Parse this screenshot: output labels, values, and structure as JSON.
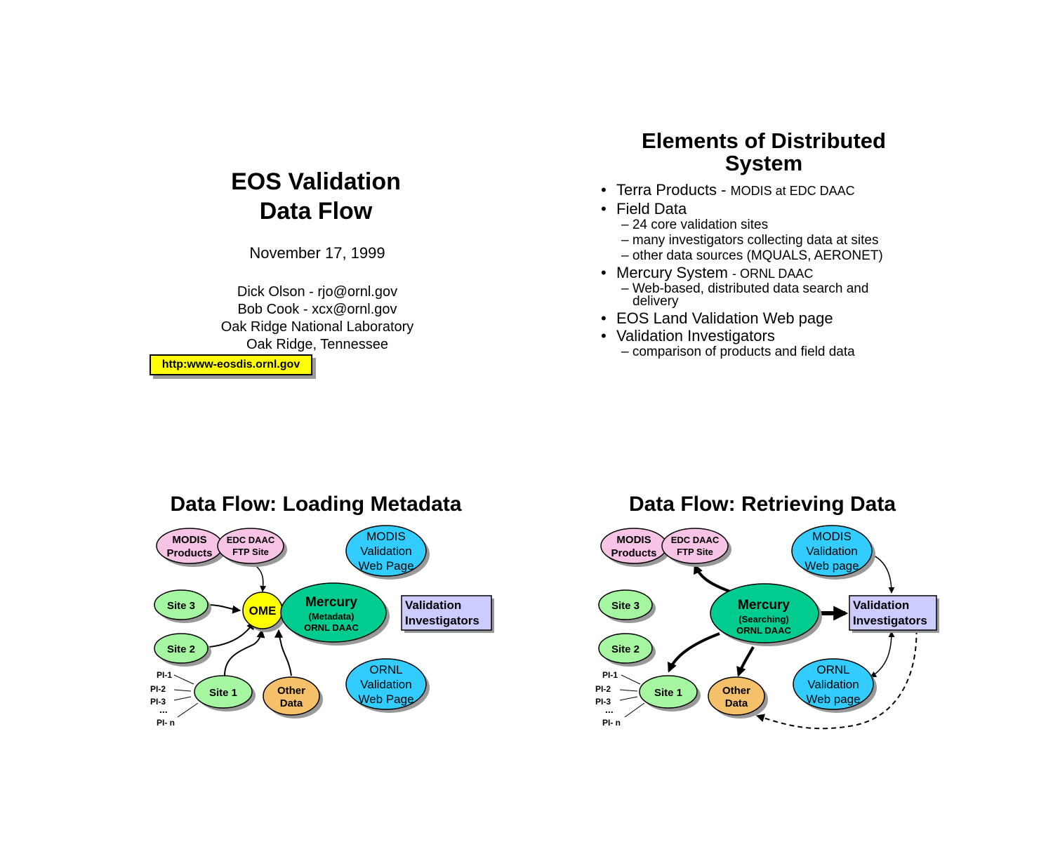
{
  "slide1": {
    "title_line1": "EOS Validation",
    "title_line2": "Data Flow",
    "date": "November 17, 1999",
    "credit1": "Dick Olson - rjo@ornl.gov",
    "credit2": "Bob Cook - xcx@ornl.gov",
    "credit3": "Oak Ridge National Laboratory",
    "credit4": "Oak Ridge, Tennessee",
    "url": "http:www-eosdis.ornl.gov"
  },
  "slide2": {
    "title_line1": "Elements of Distributed",
    "title_line2": "System",
    "bullet_char": "•",
    "b1_main": "Terra Products - ",
    "b1_small": "MODIS at EDC DAAC",
    "b2_main": "Field Data",
    "b2_sub1": "– 24 core validation sites",
    "b2_sub2": "– many investigators collecting data at sites",
    "b2_sub3": "– other data sources (MQUALS, AERONET)",
    "b3_main": "Mercury System ",
    "b3_small": "- ORNL DAAC",
    "b3_sub1a": "– Web-based, distributed data search and",
    "b3_sub1b": "delivery",
    "b4_main": "EOS Land Validation Web page",
    "b5_main": "Validation Investigators",
    "b5_sub1": "– comparison of products and field data"
  },
  "slide3": {
    "title": "Data Flow: Loading Metadata",
    "modis_products": [
      "MODIS",
      "Products"
    ],
    "edc_daac": [
      "EDC DAAC",
      "FTP Site"
    ],
    "modis_web": [
      "MODIS",
      "Validation",
      "Web Page"
    ],
    "site3": "Site 3",
    "site2": "Site 2",
    "site1": "Site 1",
    "ome": "OME",
    "mercury": "Mercury",
    "mercury_sub1": "(Metadata)",
    "mercury_sub2": "ORNL DAAC",
    "validation": [
      "Validation",
      "Investigators"
    ],
    "other_data": [
      "Other",
      "Data"
    ],
    "ornl_web": [
      "ORNL",
      "Validation",
      "Web Page"
    ],
    "pi_labels": [
      "PI-1",
      "PI-2",
      "PI-3",
      "...",
      "PI- n"
    ]
  },
  "slide4": {
    "title": "Data Flow: Retrieving Data",
    "modis_products": [
      "MODIS",
      "Products"
    ],
    "edc_daac": [
      "EDC DAAC",
      "FTP Site"
    ],
    "modis_web": [
      "MODIS",
      "Validation",
      "Web page"
    ],
    "site3": "Site 3",
    "site2": "Site 2",
    "site1": "Site 1",
    "mercury": "Mercury",
    "mercury_sub1": "(Searching)",
    "mercury_sub2": "ORNL DAAC",
    "validation": [
      "Validation",
      "Investigators"
    ],
    "other_data": [
      "Other",
      "Data"
    ],
    "ornl_web": [
      "ORNL",
      "Validation",
      "Web page"
    ],
    "pi_labels": [
      "PI-1",
      "PI-2",
      "PI-3",
      "...",
      "PI- n"
    ]
  },
  "colors": {
    "pink": "#f7c4e6",
    "green": "#a6f5a0",
    "teal": "#00cc8f",
    "cyan": "#33ccff",
    "orange": "#f5c06a",
    "lavender": "#ccccff",
    "yellow": "#ffff00",
    "shadow": "#999999"
  }
}
